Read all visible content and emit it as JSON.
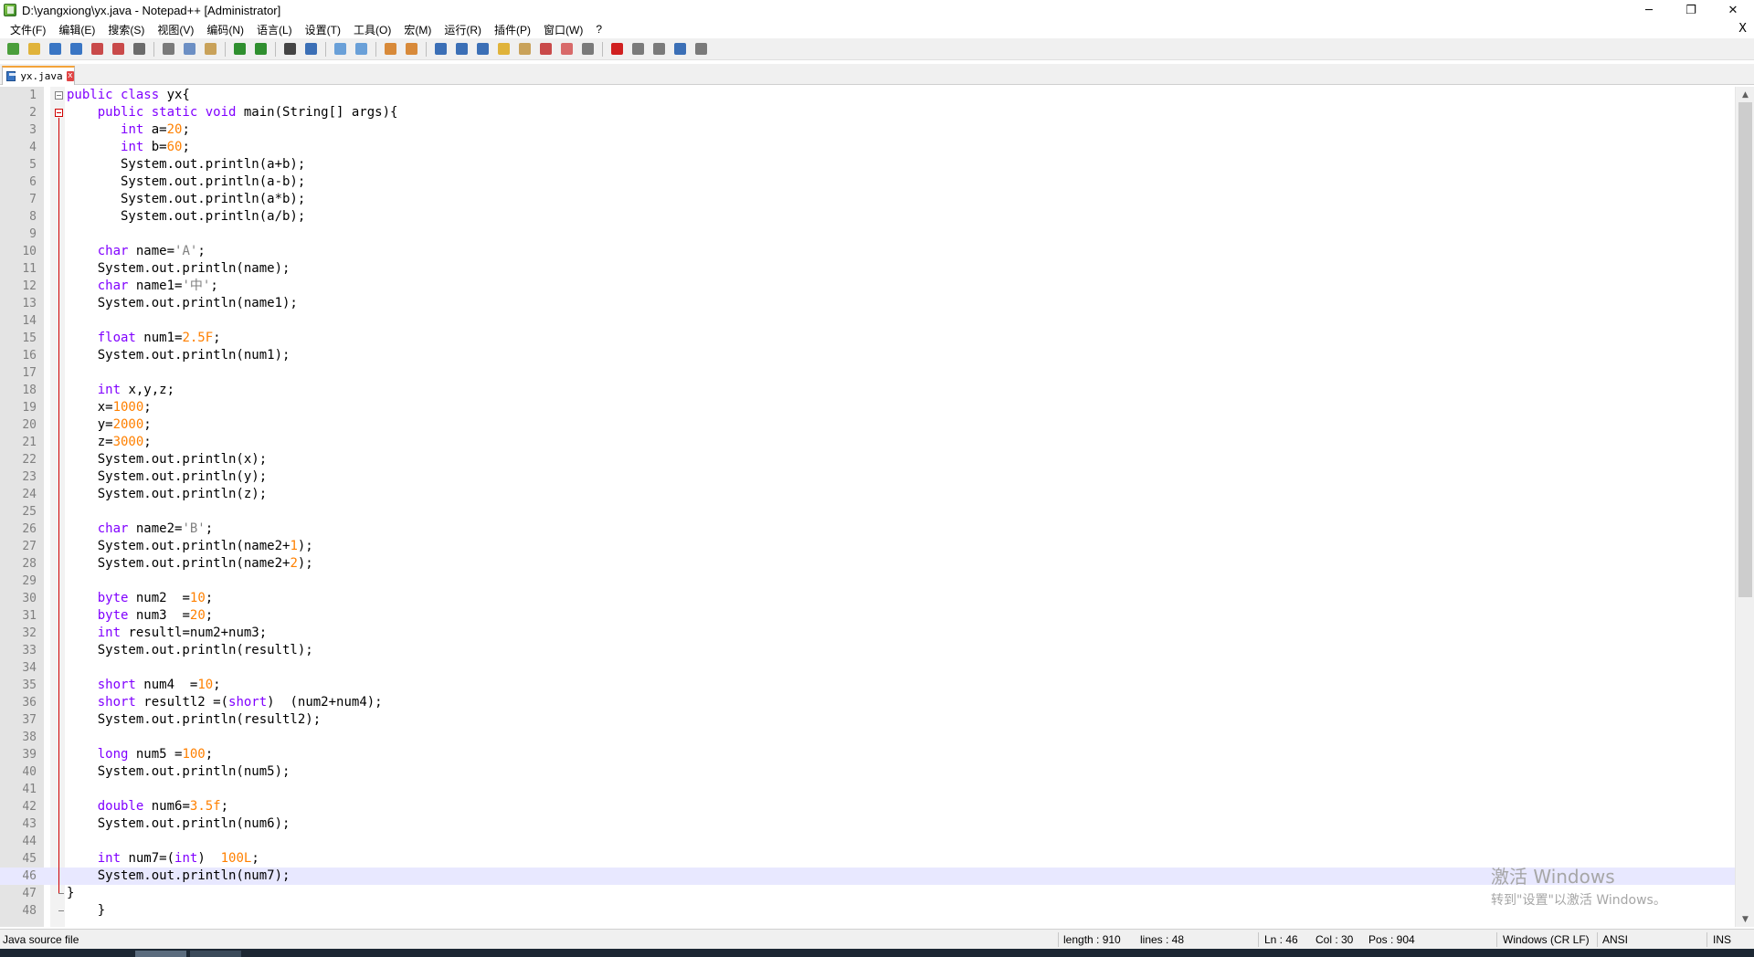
{
  "window": {
    "title": "D:\\yangxiong\\yx.java - Notepad++ [Administrator]",
    "minimize_glyph": "─",
    "restore_glyph": "❐",
    "close_glyph": "✕"
  },
  "menu": {
    "items": [
      "文件(F)",
      "编辑(E)",
      "搜索(S)",
      "视图(V)",
      "编码(N)",
      "语言(L)",
      "设置(T)",
      "工具(O)",
      "宏(M)",
      "运行(R)",
      "插件(P)",
      "窗口(W)",
      "?"
    ],
    "close_glyph": "X"
  },
  "toolbar": {
    "buttons": [
      {
        "name": "new-file-icon",
        "color": "#4a9e3b"
      },
      {
        "name": "open-file-icon",
        "color": "#e0b33a"
      },
      {
        "name": "save-icon",
        "color": "#3a76c4"
      },
      {
        "name": "save-all-icon",
        "color": "#3a76c4"
      },
      {
        "name": "close-icon",
        "color": "#c94a4a"
      },
      {
        "name": "close-all-icon",
        "color": "#c94a4a"
      },
      {
        "name": "print-icon",
        "color": "#6b6b6b"
      },
      {
        "sep": true
      },
      {
        "name": "cut-icon",
        "color": "#7a7a7a"
      },
      {
        "name": "copy-icon",
        "color": "#6c8fc4"
      },
      {
        "name": "paste-icon",
        "color": "#c9a25a"
      },
      {
        "sep": true
      },
      {
        "name": "undo-icon",
        "color": "#2f8f2f"
      },
      {
        "name": "redo-icon",
        "color": "#2f8f2f"
      },
      {
        "sep": true
      },
      {
        "name": "find-icon",
        "color": "#444444"
      },
      {
        "name": "replace-icon",
        "color": "#3b6fb6"
      },
      {
        "sep": true
      },
      {
        "name": "zoom-in-icon",
        "color": "#6aa0d8"
      },
      {
        "name": "zoom-out-icon",
        "color": "#6aa0d8"
      },
      {
        "sep": true
      },
      {
        "name": "sync-vertical-icon",
        "color": "#d88a3a"
      },
      {
        "name": "sync-horizontal-icon",
        "color": "#d88a3a"
      },
      {
        "sep": true
      },
      {
        "name": "word-wrap-icon",
        "color": "#3b6fb6"
      },
      {
        "name": "show-all-chars-icon",
        "color": "#3b6fb6"
      },
      {
        "name": "indent-guide-icon",
        "color": "#3b6fb6"
      },
      {
        "name": "udl-icon",
        "color": "#e0b33a"
      },
      {
        "name": "doc-map-icon",
        "color": "#c9a25a"
      },
      {
        "name": "function-list-icon",
        "color": "#c94a4a"
      },
      {
        "name": "folder-workspace-icon",
        "color": "#d86a6a"
      },
      {
        "name": "monitoring-icon",
        "color": "#7a7a7a"
      },
      {
        "sep": true
      },
      {
        "name": "record-macro-icon",
        "color": "#d02020"
      },
      {
        "name": "stop-recording-icon",
        "color": "#7a7a7a"
      },
      {
        "name": "playback-macro-icon",
        "color": "#7a7a7a"
      },
      {
        "name": "run-macro-multiple-icon",
        "color": "#3b6fb6"
      },
      {
        "name": "save-macro-icon",
        "color": "#7a7a7a"
      }
    ]
  },
  "tab": {
    "label": "yx.java",
    "close_glyph": "x"
  },
  "editor": {
    "current_line": 46,
    "lines": [
      [
        [
          "kw",
          "public class "
        ],
        [
          "t",
          "yx{"
        ]
      ],
      [
        [
          "t",
          "    "
        ],
        [
          "kw",
          "public static void "
        ],
        [
          "t",
          "main(String[] args){"
        ]
      ],
      [
        [
          "t",
          "       "
        ],
        [
          "kw",
          "int "
        ],
        [
          "t",
          "a="
        ],
        [
          "num",
          "20"
        ],
        [
          "t",
          ";"
        ]
      ],
      [
        [
          "t",
          "       "
        ],
        [
          "kw",
          "int "
        ],
        [
          "t",
          "b="
        ],
        [
          "num",
          "60"
        ],
        [
          "t",
          ";"
        ]
      ],
      [
        [
          "t",
          "       System.out.println(a+b);"
        ]
      ],
      [
        [
          "t",
          "       System.out.println(a-b);"
        ]
      ],
      [
        [
          "t",
          "       System.out.println(a*b);"
        ]
      ],
      [
        [
          "t",
          "       System.out.println(a/b);"
        ]
      ],
      [],
      [
        [
          "t",
          "    "
        ],
        [
          "kw",
          "char "
        ],
        [
          "t",
          "name="
        ],
        [
          "chr",
          "'A'"
        ],
        [
          "t",
          ";"
        ]
      ],
      [
        [
          "t",
          "    System.out.println(name);"
        ]
      ],
      [
        [
          "t",
          "    "
        ],
        [
          "kw",
          "char "
        ],
        [
          "t",
          "name1="
        ],
        [
          "chr",
          "'中'"
        ],
        [
          "t",
          ";"
        ]
      ],
      [
        [
          "t",
          "    System.out.println(name1);"
        ]
      ],
      [],
      [
        [
          "t",
          "    "
        ],
        [
          "kw",
          "float "
        ],
        [
          "t",
          "num1="
        ],
        [
          "num",
          "2.5F"
        ],
        [
          "t",
          ";"
        ]
      ],
      [
        [
          "t",
          "    System.out.println(num1);"
        ]
      ],
      [],
      [
        [
          "t",
          "    "
        ],
        [
          "kw",
          "int "
        ],
        [
          "t",
          "x,y,z;"
        ]
      ],
      [
        [
          "t",
          "    x="
        ],
        [
          "num",
          "1000"
        ],
        [
          "t",
          ";"
        ]
      ],
      [
        [
          "t",
          "    y="
        ],
        [
          "num",
          "2000"
        ],
        [
          "t",
          ";"
        ]
      ],
      [
        [
          "t",
          "    z="
        ],
        [
          "num",
          "3000"
        ],
        [
          "t",
          ";"
        ]
      ],
      [
        [
          "t",
          "    System.out.println(x);"
        ]
      ],
      [
        [
          "t",
          "    System.out.println(y);"
        ]
      ],
      [
        [
          "t",
          "    System.out.println(z);"
        ]
      ],
      [],
      [
        [
          "t",
          "    "
        ],
        [
          "kw",
          "char "
        ],
        [
          "t",
          "name2="
        ],
        [
          "chr",
          "'B'"
        ],
        [
          "t",
          ";"
        ]
      ],
      [
        [
          "t",
          "    System.out.println(name2+"
        ],
        [
          "num",
          "1"
        ],
        [
          "t",
          ");"
        ]
      ],
      [
        [
          "t",
          "    System.out.println(name2+"
        ],
        [
          "num",
          "2"
        ],
        [
          "t",
          ");"
        ]
      ],
      [],
      [
        [
          "t",
          "    "
        ],
        [
          "kw",
          "byte "
        ],
        [
          "t",
          "num2  ="
        ],
        [
          "num",
          "10"
        ],
        [
          "t",
          ";"
        ]
      ],
      [
        [
          "t",
          "    "
        ],
        [
          "kw",
          "byte "
        ],
        [
          "t",
          "num3  ="
        ],
        [
          "num",
          "20"
        ],
        [
          "t",
          ";"
        ]
      ],
      [
        [
          "t",
          "    "
        ],
        [
          "kw",
          "int "
        ],
        [
          "t",
          "resultl=num2+num3;"
        ]
      ],
      [
        [
          "t",
          "    System.out.println(resultl);"
        ]
      ],
      [],
      [
        [
          "t",
          "    "
        ],
        [
          "kw",
          "short "
        ],
        [
          "t",
          "num4  ="
        ],
        [
          "num",
          "10"
        ],
        [
          "t",
          ";"
        ]
      ],
      [
        [
          "t",
          "    "
        ],
        [
          "kw",
          "short "
        ],
        [
          "t",
          "resultl2 =("
        ],
        [
          "kw",
          "short"
        ],
        [
          "t",
          ")  (num2+num4);"
        ]
      ],
      [
        [
          "t",
          "    System.out.println(resultl2);"
        ]
      ],
      [],
      [
        [
          "t",
          "    "
        ],
        [
          "kw",
          "long "
        ],
        [
          "t",
          "num5 ="
        ],
        [
          "num",
          "100"
        ],
        [
          "t",
          ";"
        ]
      ],
      [
        [
          "t",
          "    System.out.println(num5);"
        ]
      ],
      [],
      [
        [
          "t",
          "    "
        ],
        [
          "kw",
          "double "
        ],
        [
          "t",
          "num6="
        ],
        [
          "num",
          "3.5f"
        ],
        [
          "t",
          ";"
        ]
      ],
      [
        [
          "t",
          "    System.out.println(num6);"
        ]
      ],
      [],
      [
        [
          "t",
          "    "
        ],
        [
          "kw",
          "int "
        ],
        [
          "t",
          "num7=("
        ],
        [
          "kw",
          "int"
        ],
        [
          "t",
          ")  "
        ],
        [
          "num",
          "100L"
        ],
        [
          "t",
          ";"
        ]
      ],
      [
        [
          "t",
          "    System.out.println(num7);"
        ]
      ],
      [
        [
          "t",
          "}"
        ]
      ],
      [
        [
          "t",
          "    }"
        ]
      ]
    ]
  },
  "scrollbar": {
    "up_glyph": "▲",
    "down_glyph": "▼"
  },
  "watermark": {
    "line1": "激活 Windows",
    "line2": "转到\"设置\"以激活 Windows。"
  },
  "status": {
    "file_type": "Java source file",
    "length": "length : 910",
    "lines": "lines : 48",
    "ln": "Ln : 46",
    "col": "Col : 30",
    "pos": "Pos : 904",
    "eol": "Windows (CR LF)",
    "encoding": "ANSI",
    "mode": "INS"
  }
}
